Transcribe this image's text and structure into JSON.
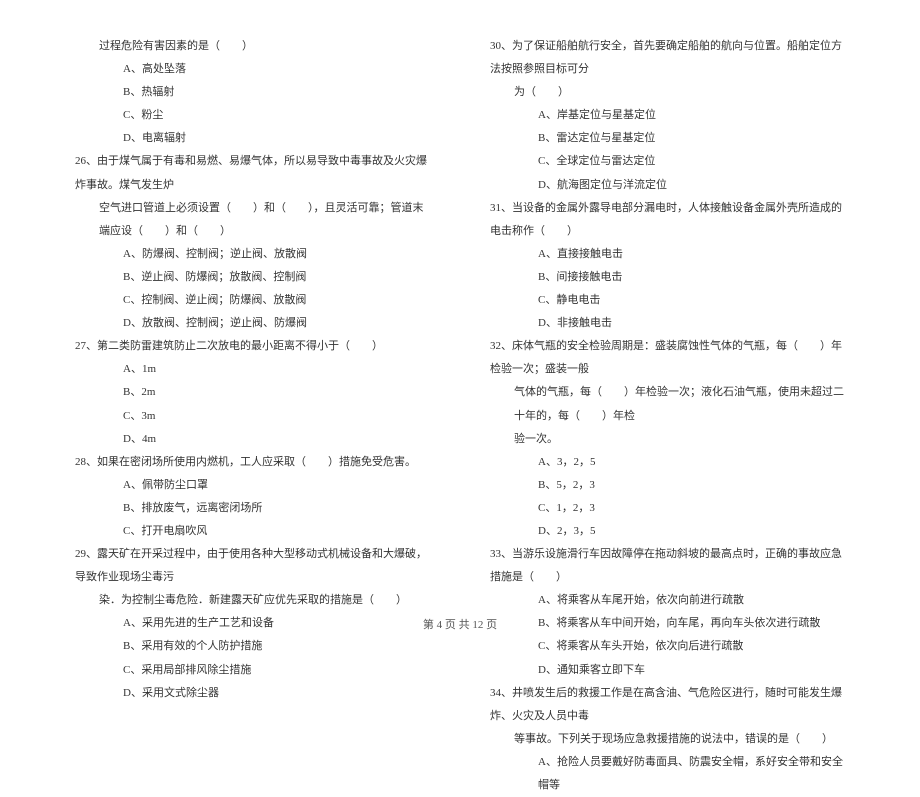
{
  "left_column": [
    {
      "indent": 1,
      "text": "过程危险有害因素的是（　　）"
    },
    {
      "indent": 2,
      "text": "A、高处坠落"
    },
    {
      "indent": 2,
      "text": "B、热辐射"
    },
    {
      "indent": 2,
      "text": "C、粉尘"
    },
    {
      "indent": 2,
      "text": "D、电离辐射"
    },
    {
      "indent": 0,
      "text": "26、由于煤气属于有毒和易燃、易爆气体，所以易导致中毒事故及火灾爆炸事故。煤气发生炉"
    },
    {
      "indent": 1,
      "text": "空气进口管道上必须设置（　　）和（　　），且灵活可靠；管道末端应设（　　）和（　　）"
    },
    {
      "indent": 2,
      "text": "A、防爆阀、控制阀；逆止阀、放散阀"
    },
    {
      "indent": 2,
      "text": "B、逆止阀、防爆阀；放散阀、控制阀"
    },
    {
      "indent": 2,
      "text": "C、控制阀、逆止阀；防爆阀、放散阀"
    },
    {
      "indent": 2,
      "text": "D、放散阀、控制阀；逆止阀、防爆阀"
    },
    {
      "indent": 0,
      "text": "27、第二类防雷建筑防止二次放电的最小距离不得小于（　　）"
    },
    {
      "indent": 2,
      "text": "A、1m"
    },
    {
      "indent": 2,
      "text": "B、2m"
    },
    {
      "indent": 2,
      "text": "C、3m"
    },
    {
      "indent": 2,
      "text": "D、4m"
    },
    {
      "indent": 0,
      "text": "28、如果在密闭场所使用内燃机，工人应采取（　　）措施免受危害。"
    },
    {
      "indent": 2,
      "text": "A、佩带防尘口罩"
    },
    {
      "indent": 2,
      "text": "B、排放废气，远离密闭场所"
    },
    {
      "indent": 2,
      "text": "C、打开电扇吹风"
    },
    {
      "indent": 0,
      "text": "29、露天矿在开采过程中，由于使用各种大型移动式机械设备和大爆破，导致作业现场尘毒污"
    },
    {
      "indent": 1,
      "text": "染．为控制尘毒危险．新建露天矿应优先采取的措施是（　　）"
    },
    {
      "indent": 2,
      "text": "A、采用先进的生产工艺和设备"
    },
    {
      "indent": 2,
      "text": "B、采用有效的个人防护措施"
    },
    {
      "indent": 2,
      "text": "C、采用局部排风除尘措施"
    },
    {
      "indent": 2,
      "text": "D、采用文式除尘器"
    }
  ],
  "right_column": [
    {
      "indent": 0,
      "text": "30、为了保证船舶航行安全，首先要确定船舶的航向与位置。船舶定位方法按照参照目标可分"
    },
    {
      "indent": 1,
      "text": "为（　　）"
    },
    {
      "indent": 2,
      "text": "A、岸基定位与星基定位"
    },
    {
      "indent": 2,
      "text": "B、雷达定位与星基定位"
    },
    {
      "indent": 2,
      "text": "C、全球定位与雷达定位"
    },
    {
      "indent": 2,
      "text": "D、航海图定位与洋流定位"
    },
    {
      "indent": 0,
      "text": "31、当设备的金属外露导电部分漏电时，人体接触设备金属外壳所造成的电击称作（　　）"
    },
    {
      "indent": 2,
      "text": "A、直接接触电击"
    },
    {
      "indent": 2,
      "text": "B、间接接触电击"
    },
    {
      "indent": 2,
      "text": "C、静电电击"
    },
    {
      "indent": 2,
      "text": "D、非接触电击"
    },
    {
      "indent": 0,
      "text": "32、床体气瓶的安全检验周期是：盛装腐蚀性气体的气瓶，每（　　）年检验一次；盛装一般"
    },
    {
      "indent": 1,
      "text": "气体的气瓶，每（　　）年检验一次；液化石油气瓶，使用未超过二十年的，每（　　）年检"
    },
    {
      "indent": 1,
      "text": "验一次。"
    },
    {
      "indent": 2,
      "text": "A、3，2，5"
    },
    {
      "indent": 2,
      "text": "B、5，2，3"
    },
    {
      "indent": 2,
      "text": "C、1，2，3"
    },
    {
      "indent": 2,
      "text": "D、2，3，5"
    },
    {
      "indent": 0,
      "text": "33、当游乐设施滑行车因故障停在拖动斜坡的最高点时，正确的事故应急措施是（　　）"
    },
    {
      "indent": 2,
      "text": "A、将乘客从车尾开始，依次向前进行疏散"
    },
    {
      "indent": 2,
      "text": "B、将乘客从车中间开始，向车尾，再向车头依次进行疏散"
    },
    {
      "indent": 2,
      "text": "C、将乘客从车头开始，依次向后进行疏散"
    },
    {
      "indent": 2,
      "text": "D、通知乘客立即下车"
    },
    {
      "indent": 0,
      "text": "34、井喷发生后的救援工作是在高含油、气危险区进行，随时可能发生爆炸、火灾及人员中毒"
    },
    {
      "indent": 1,
      "text": "等事故。下列关于现场应急救援措施的说法中，错误的是（　　）"
    },
    {
      "indent": 2,
      "text": "A、抢险人员要戴好防毒面具、防震安全帽，系好安全带和安全帽等"
    }
  ],
  "footer": "第 4 页 共 12 页"
}
